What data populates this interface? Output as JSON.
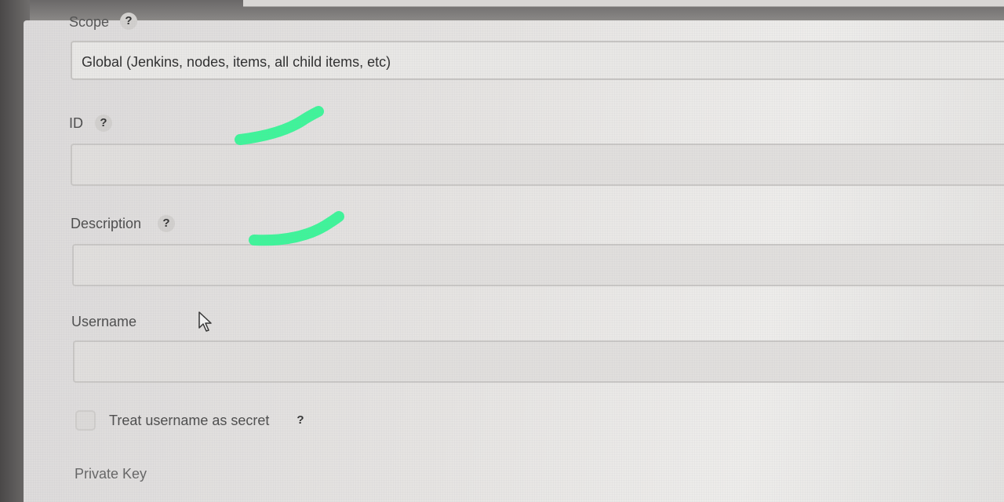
{
  "form": {
    "scope_label": "Scope",
    "scope_value": "Global (Jenkins, nodes, items, all child items, etc)",
    "id_label": "ID",
    "id_value": "",
    "description_label": "Description",
    "description_value": "",
    "username_label": "Username",
    "username_value": "",
    "treat_secret_label": "Treat username as secret",
    "treat_secret_checked": false,
    "private_key_label": "Private Key",
    "help_glyph": "?"
  },
  "annotations": {
    "marker_color": "#3ef59a"
  }
}
